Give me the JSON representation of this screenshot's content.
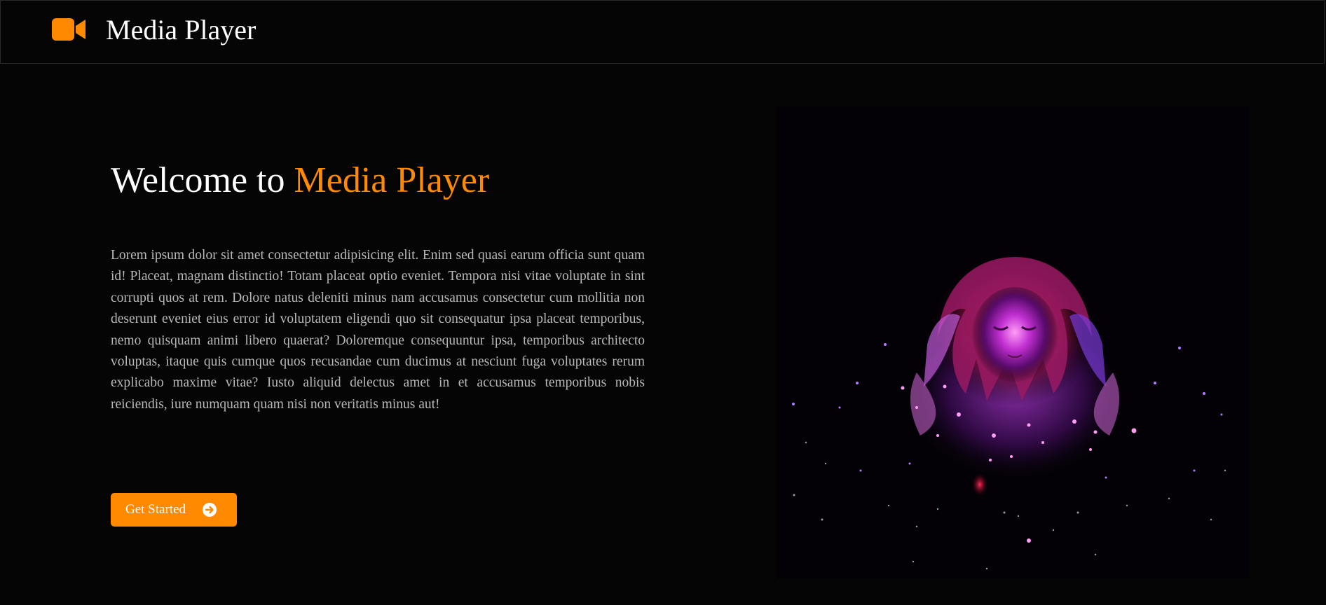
{
  "header": {
    "title": "Media Player",
    "icon": "video-camera-icon"
  },
  "hero": {
    "heading_prefix": "Welcome to ",
    "heading_accent": "Media Player",
    "body": "Lorem ipsum dolor sit amet consectetur adipisicing elit. Enim sed quasi earum officia sunt quam id! Placeat, magnam distinctio! Totam placeat optio eveniet. Tempora nisi vitae voluptate in sint corrupti quos at rem. Dolore natus deleniti minus nam accusamus consectetur cum mollitia non deserunt eveniet eius error id voluptatem eligendi quo sit consequatur ipsa placeat temporibus, nemo quisquam animi libero quaerat? Doloremque consequuntur ipsa, temporibus architecto voluptas, itaque quis cumque quos recusandae cum ducimus at nesciunt fuga voluptates rerum explicabo maxime vitae? Iusto aliquid delectus amet in et accusamus temporibus nobis reiciendis, iure numquam quam nisi non veritatis minus aut!",
    "cta_label": "Get Started",
    "cta_icon": "arrow-circle-right-icon",
    "media_icon": "anime-girl-sparkles-artwork"
  },
  "colors": {
    "accent": "#ff8a00",
    "background": "#050505",
    "text": "#ffffff",
    "body_text": "#b9b9b9"
  }
}
